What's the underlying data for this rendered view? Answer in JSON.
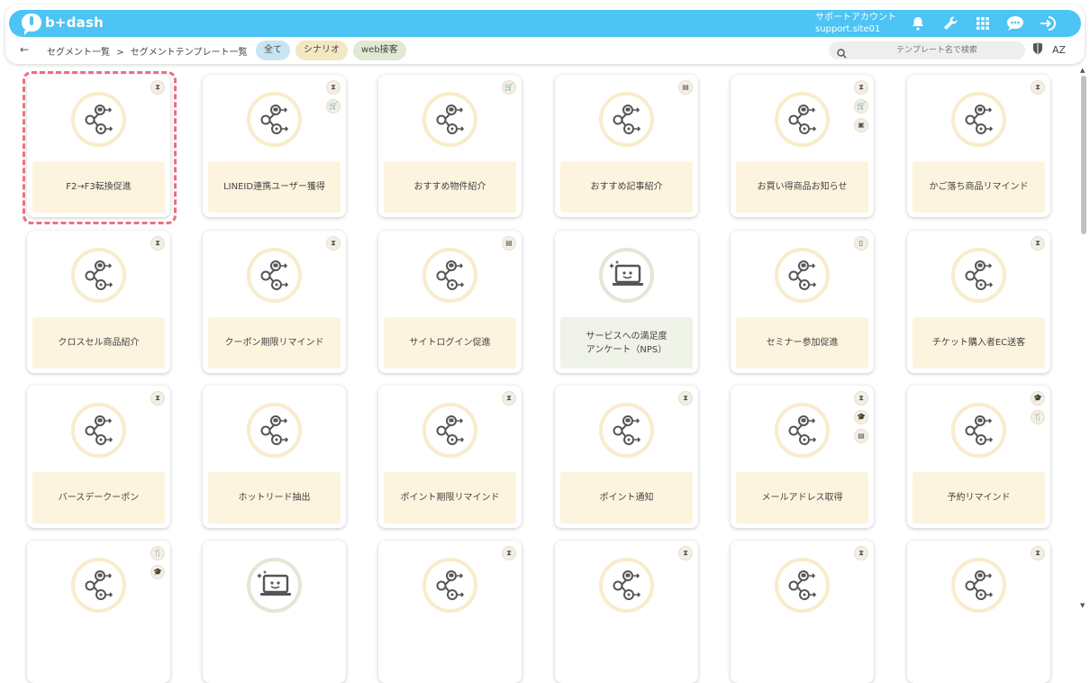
{
  "app": {
    "brand": "b+dash",
    "account_line1": "サポートアカウント",
    "account_line2": "support.site01"
  },
  "toolbar": {
    "breadcrumb": [
      "セグメント一覧",
      ">",
      "セグメントテンプレート一覧"
    ],
    "tabs": [
      "全て",
      "シナリオ",
      "web接客"
    ],
    "search_placeholder": "テンプレート名で検索",
    "sort_label": "AZ"
  },
  "cards": [
    {
      "label": "F2→F3転換促進",
      "type": "flow",
      "badges": [
        "⧗"
      ],
      "selected": true
    },
    {
      "label": "LINEID連携ユーザー獲得",
      "type": "flow",
      "badges": [
        "⧗",
        "🛒"
      ]
    },
    {
      "label": "おすすめ物件紹介",
      "type": "flow",
      "badges": [
        "🛒"
      ]
    },
    {
      "label": "おすすめ記事紹介",
      "type": "flow",
      "badges": [
        "▤"
      ]
    },
    {
      "label": "お買い得商品お知らせ",
      "type": "flow",
      "badges": [
        "⧗",
        "🛒",
        "▣"
      ]
    },
    {
      "label": "かご落ち商品リマインド",
      "type": "flow",
      "badges": [
        "⧗"
      ]
    },
    {
      "label": "クロスセル商品紹介",
      "type": "flow",
      "badges": [
        "⧗"
      ]
    },
    {
      "label": "クーポン期限リマインド",
      "type": "flow",
      "badges": [
        "⧗"
      ]
    },
    {
      "label": "サイトログイン促進",
      "type": "flow",
      "badges": [
        "▤"
      ]
    },
    {
      "label": "サービスへの満足度\nアンケート（NPS）",
      "type": "survey",
      "badges": []
    },
    {
      "label": "セミナー参加促進",
      "type": "flow",
      "badges": [
        "▯"
      ]
    },
    {
      "label": "チケット購入者EC送客",
      "type": "flow",
      "badges": [
        "⧗"
      ]
    },
    {
      "label": "バースデークーポン",
      "type": "flow",
      "badges": [
        "⧗"
      ]
    },
    {
      "label": "ホットリード抽出",
      "type": "flow",
      "badges": []
    },
    {
      "label": "ポイント期限リマインド",
      "type": "flow",
      "badges": [
        "⧗"
      ]
    },
    {
      "label": "ポイント通知",
      "type": "flow",
      "badges": [
        "⧗"
      ]
    },
    {
      "label": "メールアドレス取得",
      "type": "flow",
      "badges": [
        "⧗",
        "🎓",
        "▤"
      ]
    },
    {
      "label": "予約リマインド",
      "type": "flow",
      "badges": [
        "🎓",
        "🍴"
      ]
    },
    {
      "label": "",
      "type": "flow",
      "badges": [
        "🍴",
        "🎓"
      ]
    },
    {
      "label": "",
      "type": "survey",
      "badges": []
    },
    {
      "label": "",
      "type": "flow",
      "badges": [
        "⧗"
      ]
    },
    {
      "label": "",
      "type": "flow",
      "badges": [
        "⧗"
      ]
    },
    {
      "label": "",
      "type": "flow",
      "badges": [
        "⧗"
      ]
    },
    {
      "label": "",
      "type": "flow",
      "badges": [
        "⧗"
      ]
    }
  ],
  "colors": {
    "header": "#4cc4f4",
    "selected_outline": "#ea6f83",
    "card_label_bg": "#fdf4df",
    "circle_border": "#f8eccb"
  }
}
